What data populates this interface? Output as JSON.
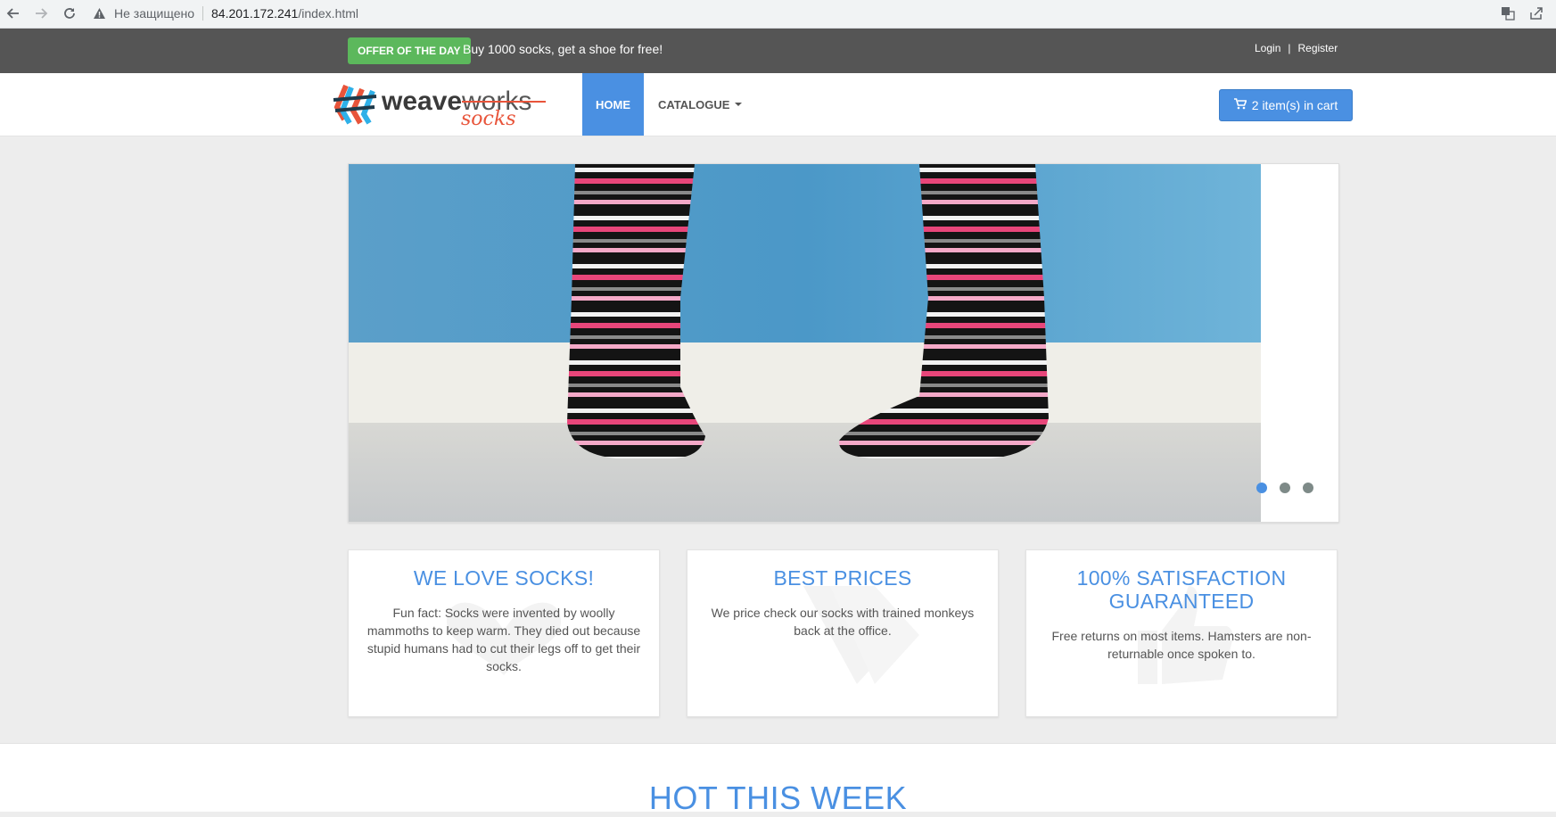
{
  "browser": {
    "not_secure": "Не защищено",
    "url_host": "84.201.172.241",
    "url_path": "/index.html"
  },
  "topbar": {
    "offer_badge": "OFFER OF THE DAY",
    "offer_text": "Buy 1000 socks, get a shoe for free!",
    "login": "Login",
    "separator": "|",
    "register": "Register"
  },
  "logo": {
    "part1": "weave",
    "part2": "works",
    "part3": "socks"
  },
  "nav": {
    "home": "HOME",
    "catalogue": "CATALOGUE",
    "cart": "2 item(s) in cart"
  },
  "carousel": {
    "slides": 3,
    "active_slide": 1
  },
  "features": [
    {
      "title": "WE LOVE SOCKS!",
      "text": "Fun fact: Socks were invented by woolly mammoths to keep warm. They died out because stupid humans had to cut their legs off to get their socks.",
      "icon": "heart-icon"
    },
    {
      "title": "BEST PRICES",
      "text": "We price check our socks with trained monkeys back at the office.",
      "icon": "tag-icon"
    },
    {
      "title": "100% SATISFACTION GUARANTEED",
      "text": "Free returns on most items. Hamsters are non-returnable once spoken to.",
      "icon": "thumbs-up-icon"
    }
  ],
  "hot": {
    "title": "HOT THIS WEEK"
  },
  "colors": {
    "accent": "#4a90e2",
    "offer_green": "#5cb85c",
    "topbar": "#555555"
  }
}
